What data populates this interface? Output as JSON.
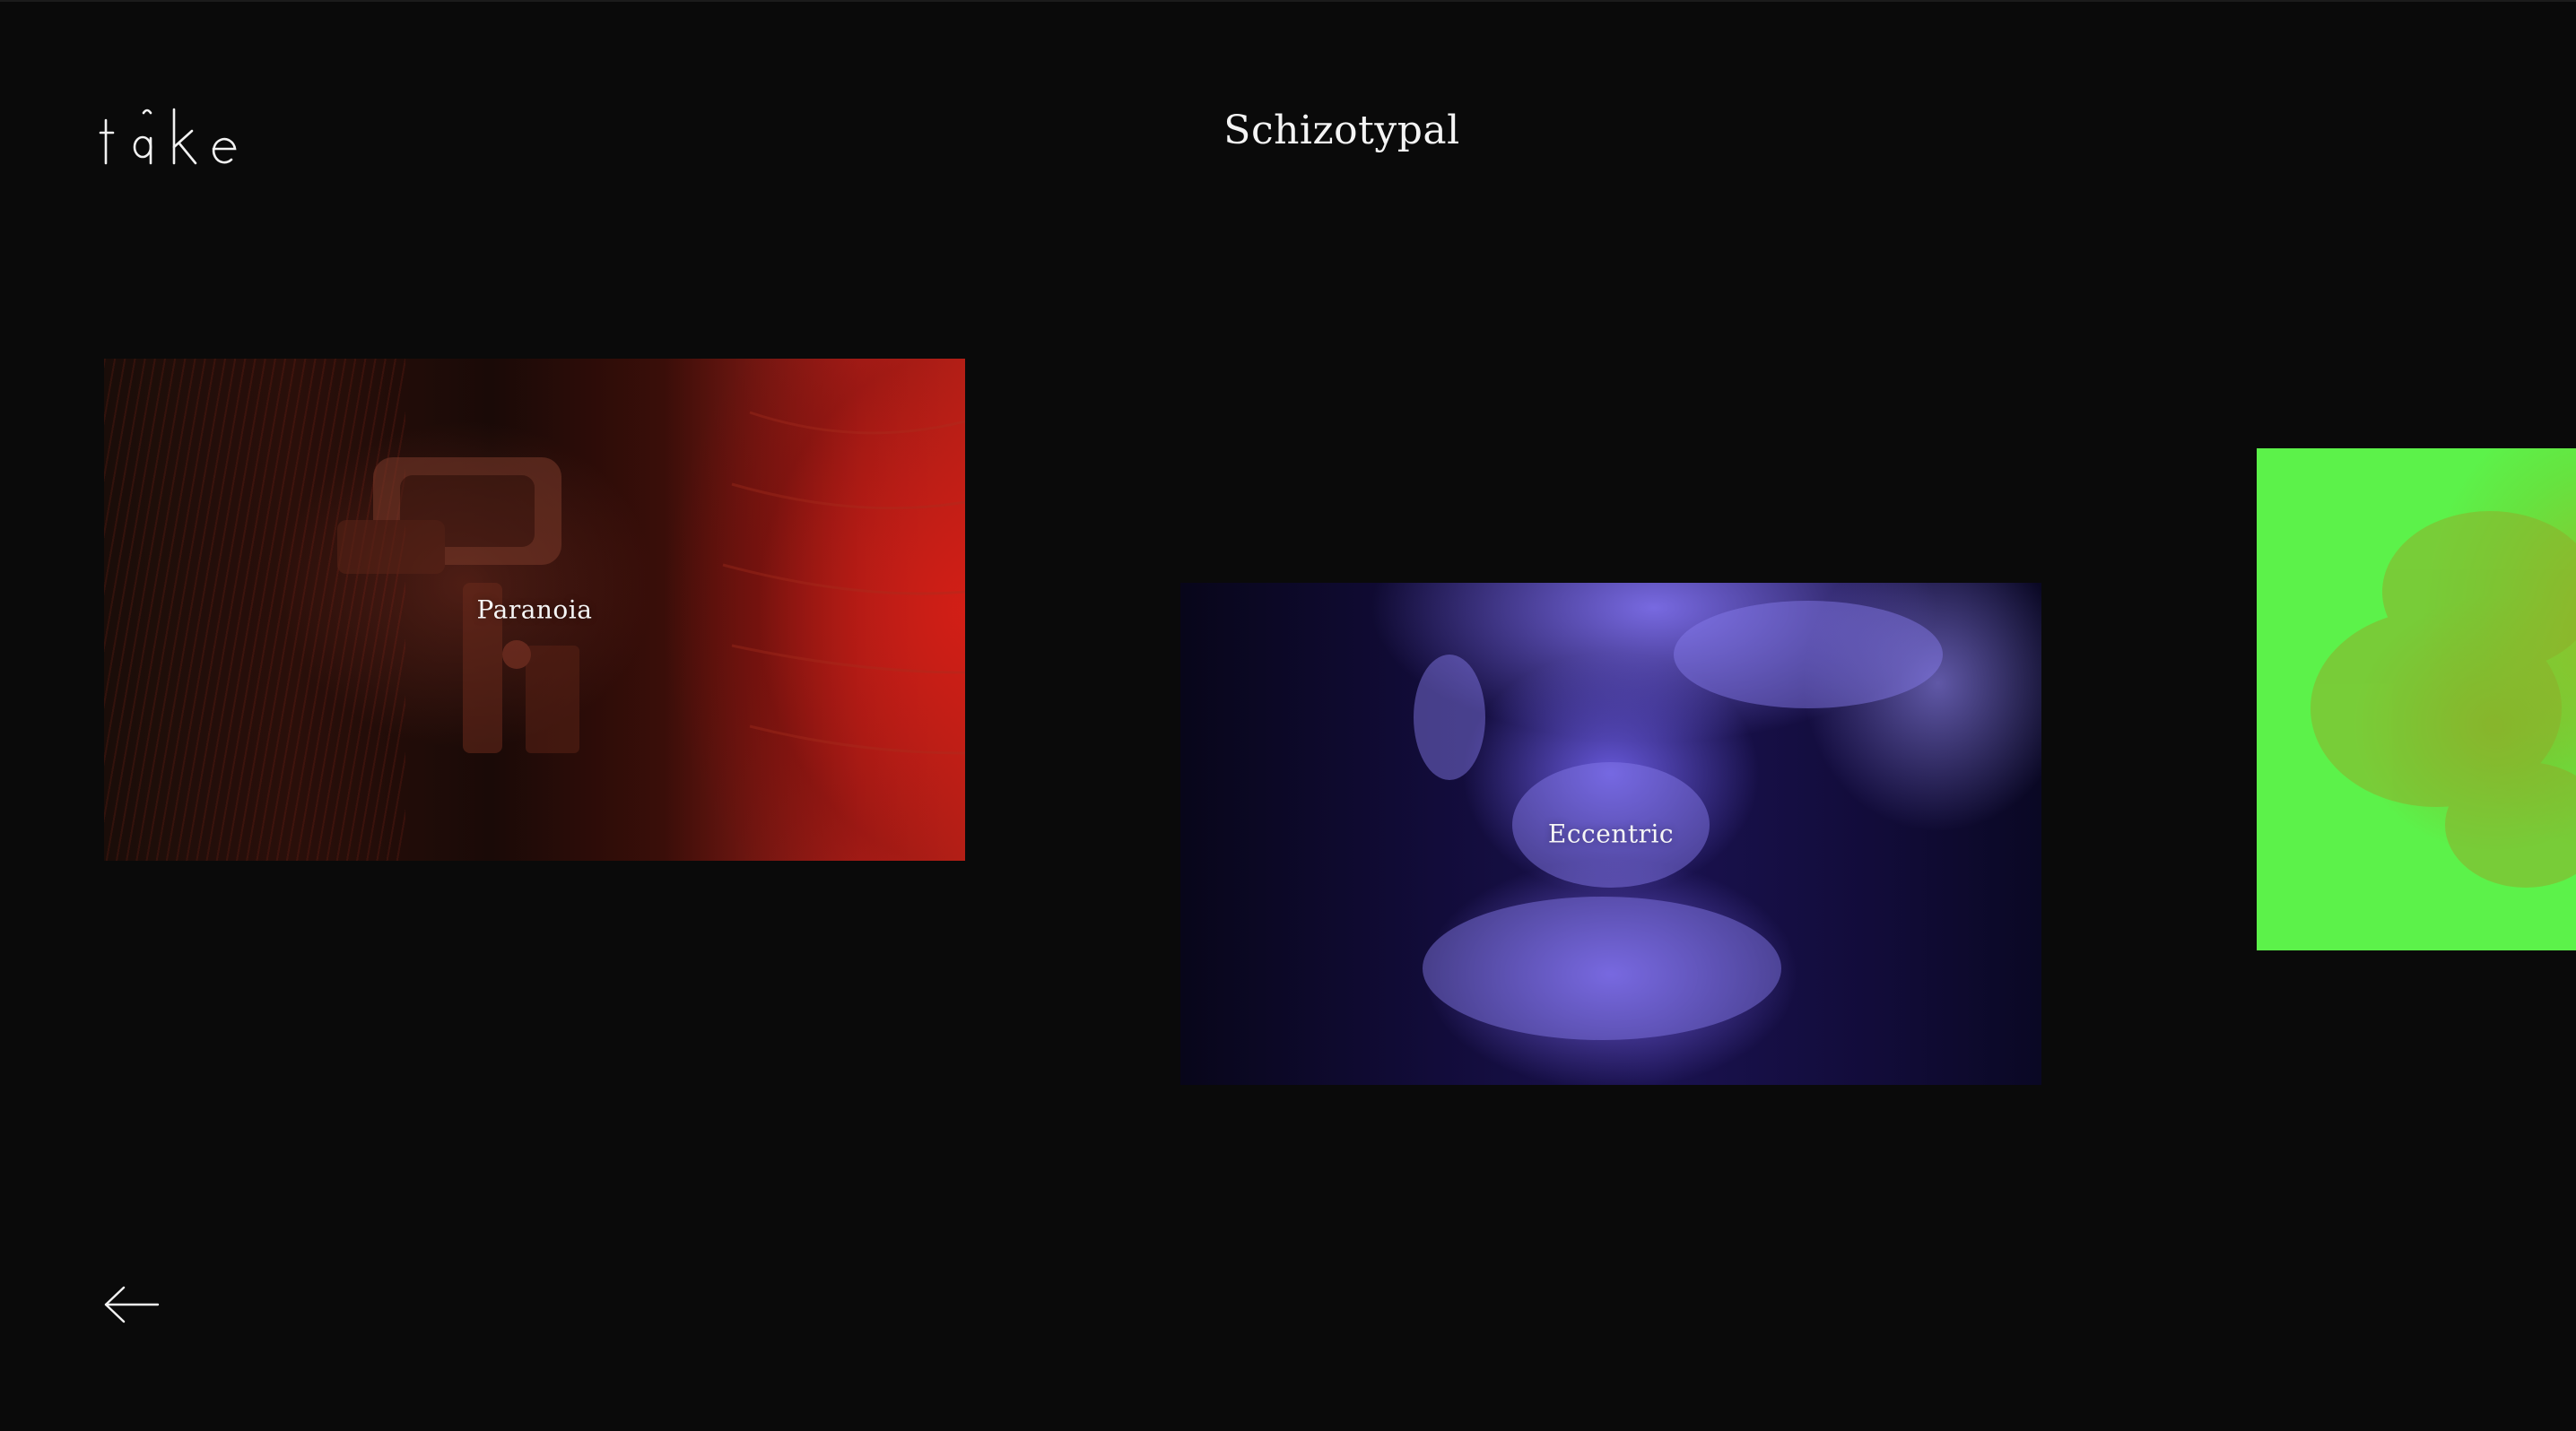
{
  "header": {
    "logo_text": "take",
    "title": "Schizotypal"
  },
  "gallery": {
    "items": [
      {
        "label": "Paranoia",
        "accent": "#c82a1e"
      },
      {
        "label": "Eccentric",
        "accent": "#6a5ae6"
      },
      {
        "label": "",
        "accent": "#5cf24a"
      }
    ]
  },
  "nav": {
    "back_icon": "arrow-left-icon"
  }
}
